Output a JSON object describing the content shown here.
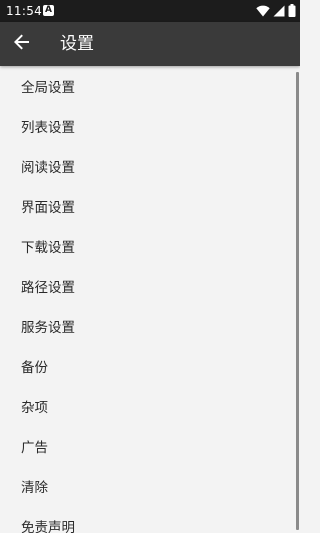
{
  "status_bar": {
    "time": "11:54",
    "app_icon_letter": "A",
    "wifi_icon": "wifi-icon",
    "signal_icon": "cellular-signal-icon",
    "battery_icon": "battery-icon"
  },
  "header": {
    "back_icon": "arrow-back-icon",
    "title": "设置"
  },
  "settings_list": {
    "items": [
      {
        "label": "全局设置"
      },
      {
        "label": "列表设置"
      },
      {
        "label": "阅读设置"
      },
      {
        "label": "界面设置"
      },
      {
        "label": "下载设置"
      },
      {
        "label": "路径设置"
      },
      {
        "label": "服务设置"
      },
      {
        "label": "备份"
      },
      {
        "label": "杂项"
      },
      {
        "label": "广告"
      },
      {
        "label": "清除"
      },
      {
        "label": "免责声明"
      }
    ]
  },
  "colors": {
    "status_bar_bg": "#1c1c1c",
    "app_bar_bg": "#3a3a3a",
    "list_bg": "#f3f3f3",
    "item_text": "#2a2a2a"
  }
}
